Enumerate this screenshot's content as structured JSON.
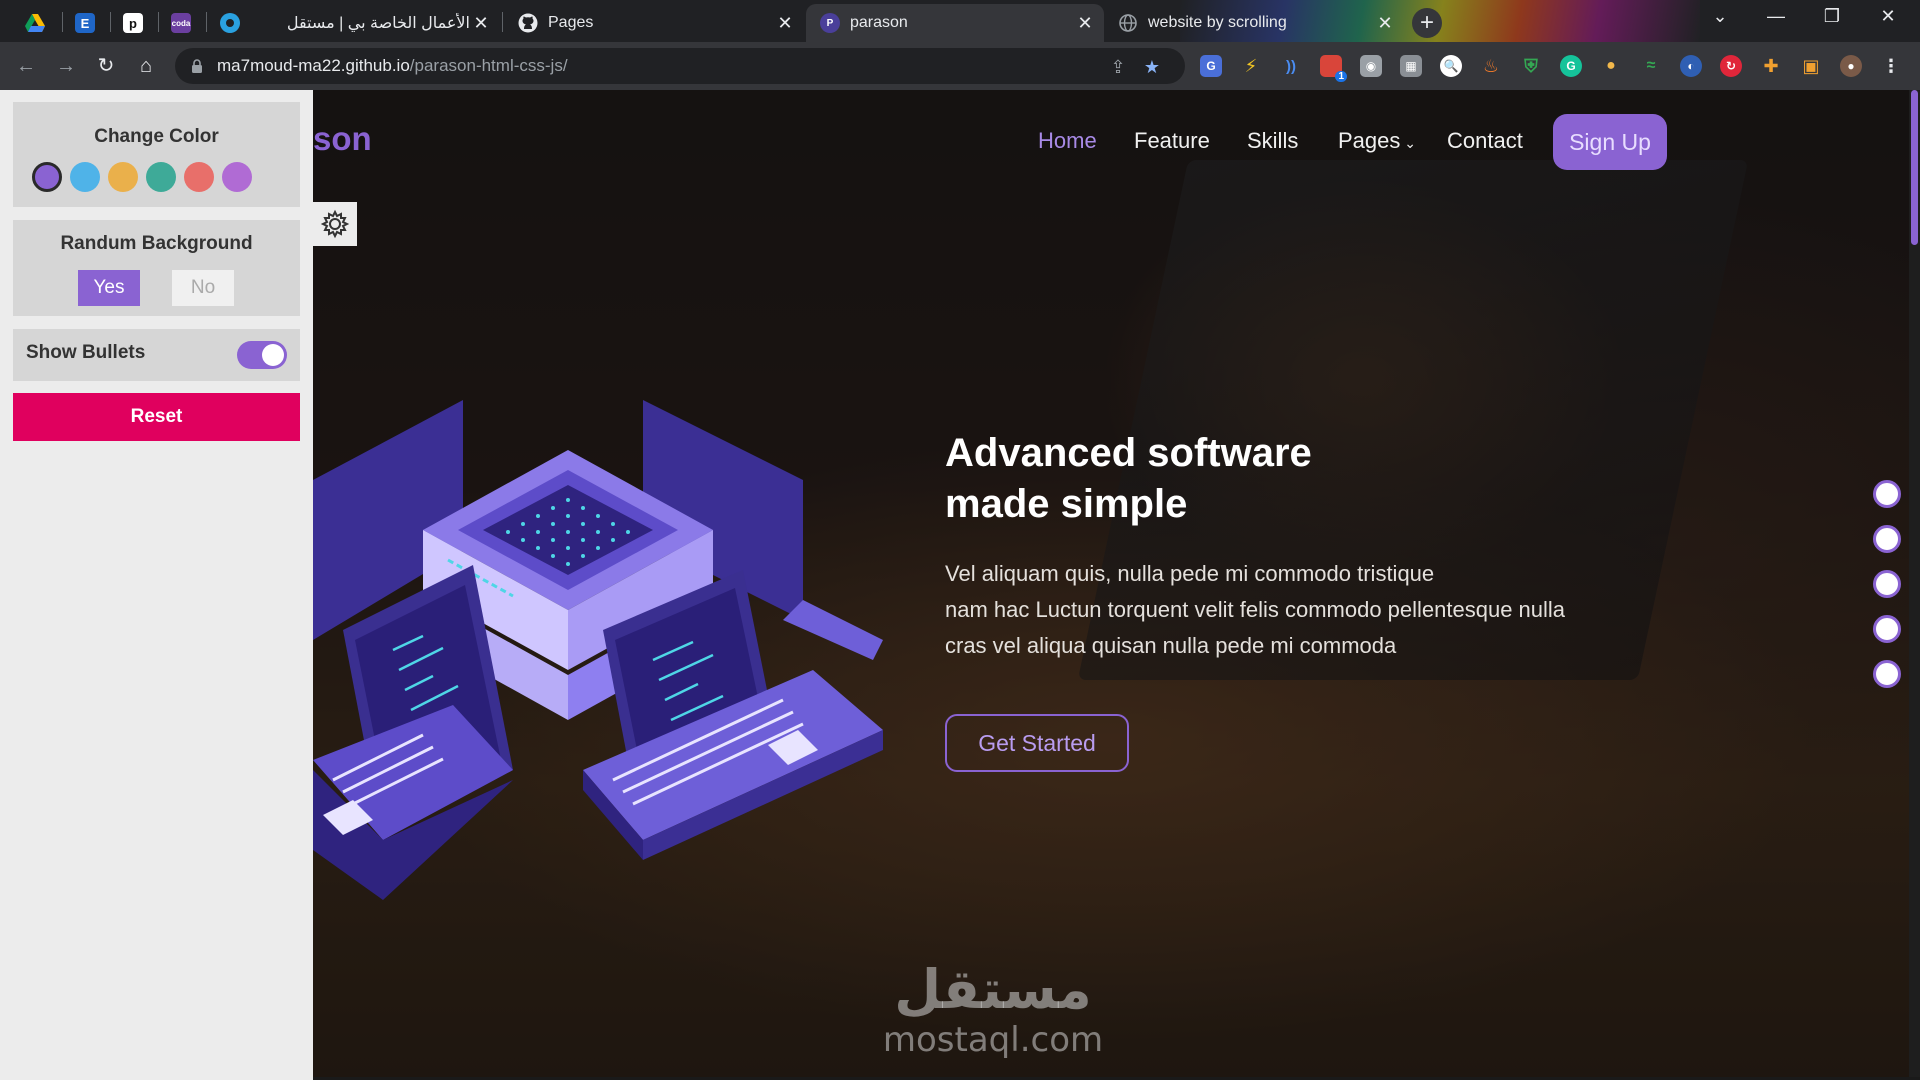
{
  "browser": {
    "tabs": [
      {
        "title": "",
        "icon": "google-drive-icon",
        "pinned": true
      },
      {
        "title": "",
        "icon": "envato-icon",
        "pinned": true
      },
      {
        "title": "",
        "icon": "p-app-icon",
        "pinned": true
      },
      {
        "title": "",
        "icon": "coda-icon",
        "pinned": true
      },
      {
        "title": "الأعمال الخاصة بي | مستقل",
        "icon": "mostaql-icon",
        "pinned": false
      },
      {
        "title": "Pages",
        "icon": "github-icon",
        "pinned": false
      },
      {
        "title": "parason",
        "icon": "parason-icon",
        "pinned": false,
        "active": true
      },
      {
        "title": "website by scrolling",
        "icon": "globe-icon",
        "pinned": false
      }
    ],
    "url_domain": "ma7moud-ma22.github.io",
    "url_path": "/parason-html-css-js/",
    "extension_badge": "1"
  },
  "settings": {
    "change_color_title": "Change Color",
    "colors": [
      "#8a63d2",
      "#4fb3e8",
      "#eab04b",
      "#3eaa98",
      "#e86f6a",
      "#b06bd4"
    ],
    "selected_color": "#8a63d2",
    "random_background_title": "Randum Background",
    "yes_label": "Yes",
    "no_label": "No",
    "random_background": "Yes",
    "show_bullets_label": "Show Bullets",
    "show_bullets": true,
    "reset_label": "Reset"
  },
  "site": {
    "brand": "son",
    "nav": [
      "Home",
      "Feature",
      "Skills",
      "Pages",
      "Contact"
    ],
    "active_nav": "Home",
    "signup_label": "Sign Up",
    "headline_line1": "Advanced software",
    "headline_line2": "made simple",
    "subtext_line1": "Vel aliquam quis, nulla pede mi commodo tristique",
    "subtext_line2": "nam hac Luctun torquent velit felis commodo pellentesque nulla",
    "subtext_line3": "cras vel aliqua quisan nulla pede mi commoda",
    "cta_label": "Get Started",
    "bullet_count": 5,
    "accent": "#8a63d2"
  },
  "watermark": {
    "arabic": "مستقل",
    "latin": "mostaql.com"
  }
}
